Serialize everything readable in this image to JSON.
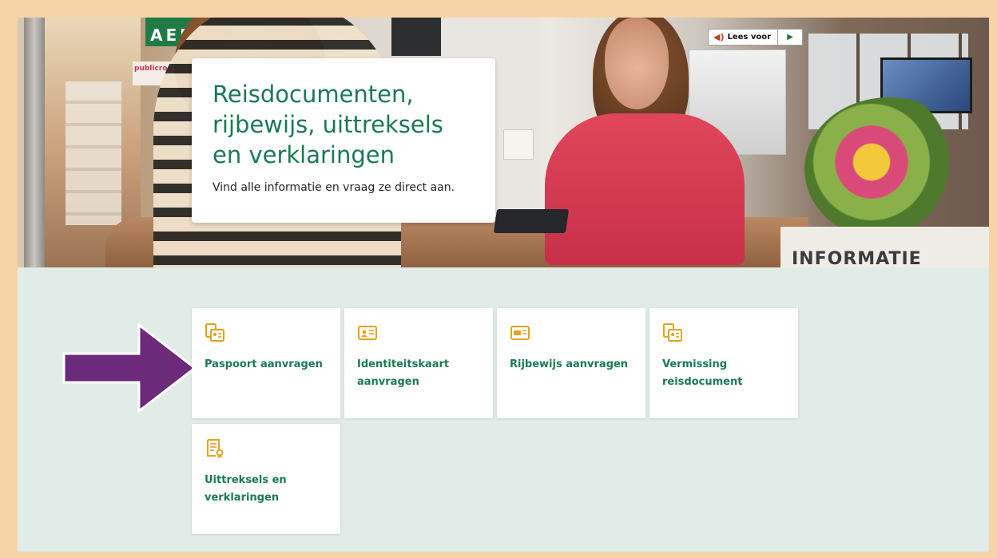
{
  "hero": {
    "aed_sign": "AED",
    "publicroam_sign": "publicroam",
    "counter_sign": "INFORMATIE",
    "read_aloud": {
      "label": "Lees voor",
      "play": "▶"
    }
  },
  "intro": {
    "title": "Reisdocumenten, rijbewijs, uittreksels en verklaringen",
    "subtitle": "Vind alle informatie en vraag ze direct aan."
  },
  "tiles": [
    {
      "label": "Paspoort aanvragen",
      "icon": "passport-icon"
    },
    {
      "label": "Identiteitskaart aanvragen",
      "icon": "id-card-icon"
    },
    {
      "label": "Rijbewijs aanvragen",
      "icon": "drivers-license-icon"
    },
    {
      "label": "Vermissing reisdocument",
      "icon": "lost-document-icon"
    },
    {
      "label": "Uittreksels en verklaringen",
      "icon": "certificate-icon"
    }
  ],
  "colors": {
    "page_border": "#f6d4a8",
    "section_bg": "#e1ece8",
    "heading_green": "#1a7a52",
    "icon_orange": "#e6a21a",
    "arrow_purple": "#6b2a7a"
  }
}
